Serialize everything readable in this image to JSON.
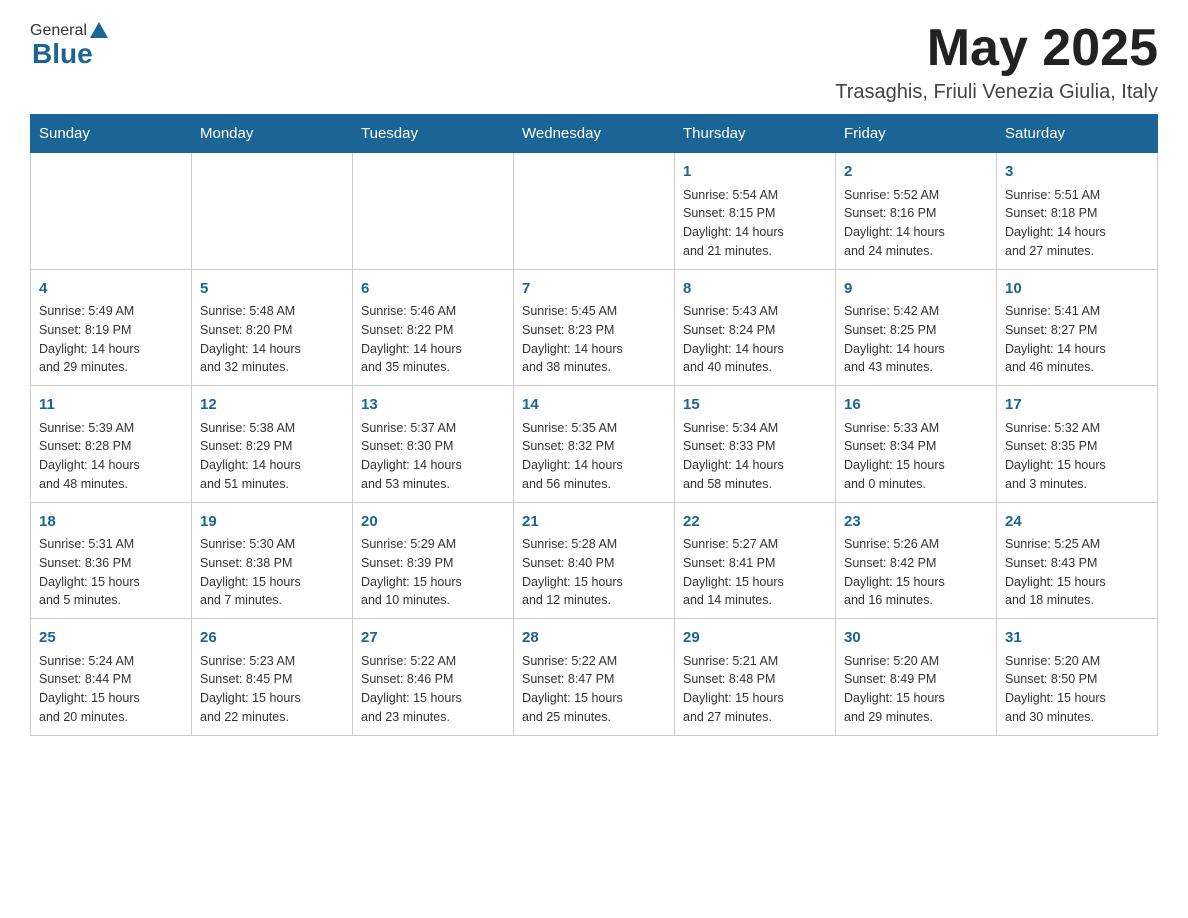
{
  "header": {
    "logo_general": "General",
    "logo_blue": "Blue",
    "month_title": "May 2025",
    "location": "Trasaghis, Friuli Venezia Giulia, Italy"
  },
  "weekdays": [
    "Sunday",
    "Monday",
    "Tuesday",
    "Wednesday",
    "Thursday",
    "Friday",
    "Saturday"
  ],
  "weeks": [
    [
      {
        "day": "",
        "info": ""
      },
      {
        "day": "",
        "info": ""
      },
      {
        "day": "",
        "info": ""
      },
      {
        "day": "",
        "info": ""
      },
      {
        "day": "1",
        "info": "Sunrise: 5:54 AM\nSunset: 8:15 PM\nDaylight: 14 hours\nand 21 minutes."
      },
      {
        "day": "2",
        "info": "Sunrise: 5:52 AM\nSunset: 8:16 PM\nDaylight: 14 hours\nand 24 minutes."
      },
      {
        "day": "3",
        "info": "Sunrise: 5:51 AM\nSunset: 8:18 PM\nDaylight: 14 hours\nand 27 minutes."
      }
    ],
    [
      {
        "day": "4",
        "info": "Sunrise: 5:49 AM\nSunset: 8:19 PM\nDaylight: 14 hours\nand 29 minutes."
      },
      {
        "day": "5",
        "info": "Sunrise: 5:48 AM\nSunset: 8:20 PM\nDaylight: 14 hours\nand 32 minutes."
      },
      {
        "day": "6",
        "info": "Sunrise: 5:46 AM\nSunset: 8:22 PM\nDaylight: 14 hours\nand 35 minutes."
      },
      {
        "day": "7",
        "info": "Sunrise: 5:45 AM\nSunset: 8:23 PM\nDaylight: 14 hours\nand 38 minutes."
      },
      {
        "day": "8",
        "info": "Sunrise: 5:43 AM\nSunset: 8:24 PM\nDaylight: 14 hours\nand 40 minutes."
      },
      {
        "day": "9",
        "info": "Sunrise: 5:42 AM\nSunset: 8:25 PM\nDaylight: 14 hours\nand 43 minutes."
      },
      {
        "day": "10",
        "info": "Sunrise: 5:41 AM\nSunset: 8:27 PM\nDaylight: 14 hours\nand 46 minutes."
      }
    ],
    [
      {
        "day": "11",
        "info": "Sunrise: 5:39 AM\nSunset: 8:28 PM\nDaylight: 14 hours\nand 48 minutes."
      },
      {
        "day": "12",
        "info": "Sunrise: 5:38 AM\nSunset: 8:29 PM\nDaylight: 14 hours\nand 51 minutes."
      },
      {
        "day": "13",
        "info": "Sunrise: 5:37 AM\nSunset: 8:30 PM\nDaylight: 14 hours\nand 53 minutes."
      },
      {
        "day": "14",
        "info": "Sunrise: 5:35 AM\nSunset: 8:32 PM\nDaylight: 14 hours\nand 56 minutes."
      },
      {
        "day": "15",
        "info": "Sunrise: 5:34 AM\nSunset: 8:33 PM\nDaylight: 14 hours\nand 58 minutes."
      },
      {
        "day": "16",
        "info": "Sunrise: 5:33 AM\nSunset: 8:34 PM\nDaylight: 15 hours\nand 0 minutes."
      },
      {
        "day": "17",
        "info": "Sunrise: 5:32 AM\nSunset: 8:35 PM\nDaylight: 15 hours\nand 3 minutes."
      }
    ],
    [
      {
        "day": "18",
        "info": "Sunrise: 5:31 AM\nSunset: 8:36 PM\nDaylight: 15 hours\nand 5 minutes."
      },
      {
        "day": "19",
        "info": "Sunrise: 5:30 AM\nSunset: 8:38 PM\nDaylight: 15 hours\nand 7 minutes."
      },
      {
        "day": "20",
        "info": "Sunrise: 5:29 AM\nSunset: 8:39 PM\nDaylight: 15 hours\nand 10 minutes."
      },
      {
        "day": "21",
        "info": "Sunrise: 5:28 AM\nSunset: 8:40 PM\nDaylight: 15 hours\nand 12 minutes."
      },
      {
        "day": "22",
        "info": "Sunrise: 5:27 AM\nSunset: 8:41 PM\nDaylight: 15 hours\nand 14 minutes."
      },
      {
        "day": "23",
        "info": "Sunrise: 5:26 AM\nSunset: 8:42 PM\nDaylight: 15 hours\nand 16 minutes."
      },
      {
        "day": "24",
        "info": "Sunrise: 5:25 AM\nSunset: 8:43 PM\nDaylight: 15 hours\nand 18 minutes."
      }
    ],
    [
      {
        "day": "25",
        "info": "Sunrise: 5:24 AM\nSunset: 8:44 PM\nDaylight: 15 hours\nand 20 minutes."
      },
      {
        "day": "26",
        "info": "Sunrise: 5:23 AM\nSunset: 8:45 PM\nDaylight: 15 hours\nand 22 minutes."
      },
      {
        "day": "27",
        "info": "Sunrise: 5:22 AM\nSunset: 8:46 PM\nDaylight: 15 hours\nand 23 minutes."
      },
      {
        "day": "28",
        "info": "Sunrise: 5:22 AM\nSunset: 8:47 PM\nDaylight: 15 hours\nand 25 minutes."
      },
      {
        "day": "29",
        "info": "Sunrise: 5:21 AM\nSunset: 8:48 PM\nDaylight: 15 hours\nand 27 minutes."
      },
      {
        "day": "30",
        "info": "Sunrise: 5:20 AM\nSunset: 8:49 PM\nDaylight: 15 hours\nand 29 minutes."
      },
      {
        "day": "31",
        "info": "Sunrise: 5:20 AM\nSunset: 8:50 PM\nDaylight: 15 hours\nand 30 minutes."
      }
    ]
  ]
}
